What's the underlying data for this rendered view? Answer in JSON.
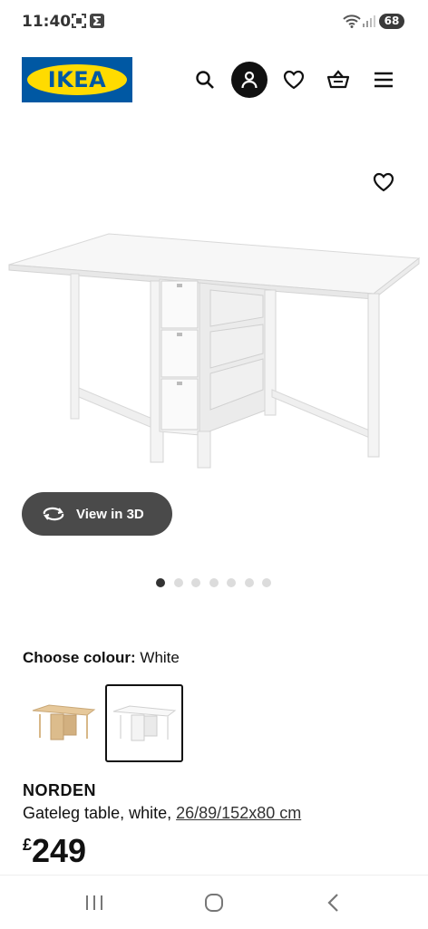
{
  "status_bar": {
    "time": "11:40",
    "battery": "68",
    "icons": [
      "screenshot-icon",
      "sigma-app-icon",
      "wifi-icon",
      "signal-icon"
    ]
  },
  "header": {
    "logo_text": "IKEA",
    "icons": [
      "search-icon",
      "account-icon",
      "heart-icon",
      "basket-icon",
      "menu-icon"
    ]
  },
  "gallery": {
    "view_3d_label": "View in 3D",
    "dots_count": 7,
    "active_dot": 0
  },
  "colour": {
    "label": "Choose colour:",
    "selected": "White",
    "options": [
      "birch",
      "white"
    ]
  },
  "product": {
    "name": "NORDEN",
    "description": "Gateleg table, white,",
    "dimensions": "26/89/152x80 cm",
    "currency": "£",
    "price": "249"
  },
  "colors": {
    "ikea_blue": "#0058a3",
    "ikea_yellow": "#ffdb00",
    "button_dark": "#4a4a4a"
  }
}
